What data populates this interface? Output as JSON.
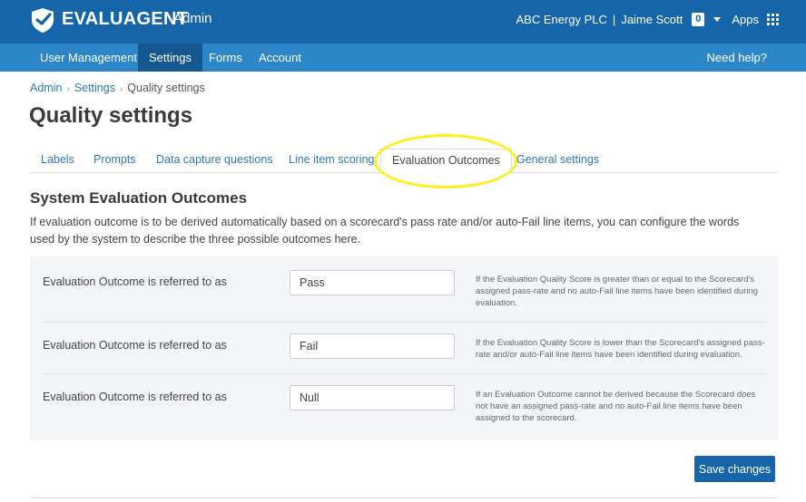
{
  "header": {
    "brand": "EVALUAGENT",
    "brand_sub": "Admin",
    "company": "ABC Energy PLC",
    "separator": "|",
    "user": "Jaime Scott",
    "notifications": "0",
    "apps_label": "Apps",
    "icons": [
      "shield-logo-icon",
      "caret-down-icon",
      "apps-grid-icon"
    ]
  },
  "nav": {
    "items": [
      {
        "label": "User Management"
      },
      {
        "label": "Settings"
      },
      {
        "label": "Forms"
      },
      {
        "label": "Account"
      }
    ],
    "active": "Settings",
    "help": "Need help?"
  },
  "breadcrumb": [
    "Admin",
    "Settings",
    "Quality settings"
  ],
  "page_title": "Quality settings",
  "tabs": {
    "items": [
      "Labels",
      "Prompts",
      "Data capture questions",
      "Line item scoring",
      "Evaluation Outcomes",
      "General settings"
    ],
    "active": "Evaluation Outcomes"
  },
  "section": {
    "title": "System Evaluation Outcomes",
    "description": "If evaluation outcome is to be derived automatically based on a scorecard's pass rate and/or auto-Fail line items, you can configure the words used by the system to describe the three possible outcomes here."
  },
  "outcomes": [
    {
      "label": "Evaluation Outcome is referred to as",
      "value": "Pass",
      "help": "If the Evaluation Quality Score is greater than or equal to the Scorecard's assigned pass-rate and no auto-Fail line items have been identified during evaluation."
    },
    {
      "label": "Evaluation Outcome is referred to as",
      "value": "Fail",
      "help": "If the Evaluation Quality Score is lower than the Scorecard's assigned pass-rate and/or auto-Fail line items have been identified during evaluation."
    },
    {
      "label": "Evaluation Outcome is referred to as",
      "value": "Null",
      "help": "If an Evaluation Outcome cannot be derived because the Scorecard does not have an assigned pass-rate and no auto-Fail line items have been assigned to the scorecard."
    }
  ],
  "save_label": "Save changes",
  "colors": {
    "header_bg": "#1565a8",
    "nav_bg": "#2c86c7",
    "nav_active": "#14588f",
    "link": "#2b79b8",
    "panel_bg": "#f3f5f8",
    "highlight": "#ffef1a"
  }
}
